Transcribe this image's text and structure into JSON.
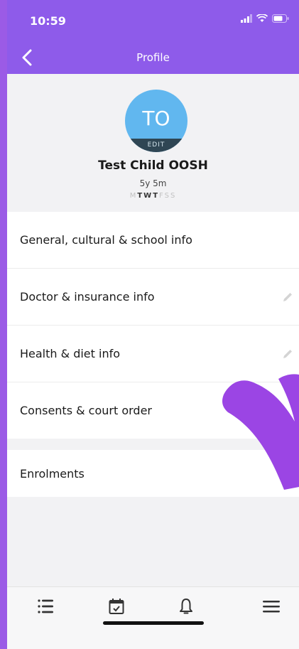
{
  "status_bar": {
    "time": "10:59"
  },
  "nav": {
    "title": "Profile"
  },
  "profile": {
    "initials": "TO",
    "edit_label": "EDIT",
    "name": "Test Child OOSH",
    "age": "5y 5m",
    "days": [
      {
        "letter": "M",
        "active": false
      },
      {
        "letter": "T",
        "active": true
      },
      {
        "letter": "W",
        "active": true
      },
      {
        "letter": "T",
        "active": true
      },
      {
        "letter": "F",
        "active": false
      },
      {
        "letter": "S",
        "active": false
      },
      {
        "letter": "S",
        "active": false
      }
    ]
  },
  "menu_primary": [
    {
      "label": "General, cultural & school info"
    },
    {
      "label": "Doctor & insurance info"
    },
    {
      "label": "Health & diet info"
    },
    {
      "label": "Consents & court order"
    }
  ],
  "menu_secondary": [
    {
      "label": "Enrolments"
    }
  ],
  "tabs": [
    {
      "icon": "list-icon"
    },
    {
      "icon": "calendar-check-icon"
    },
    {
      "icon": "bell-icon"
    },
    {
      "icon": "hamburger-menu-icon"
    }
  ],
  "colors": {
    "header": "#8e5bea",
    "avatar": "#61b7ef",
    "annotation_arrow": "#9b45e4"
  }
}
